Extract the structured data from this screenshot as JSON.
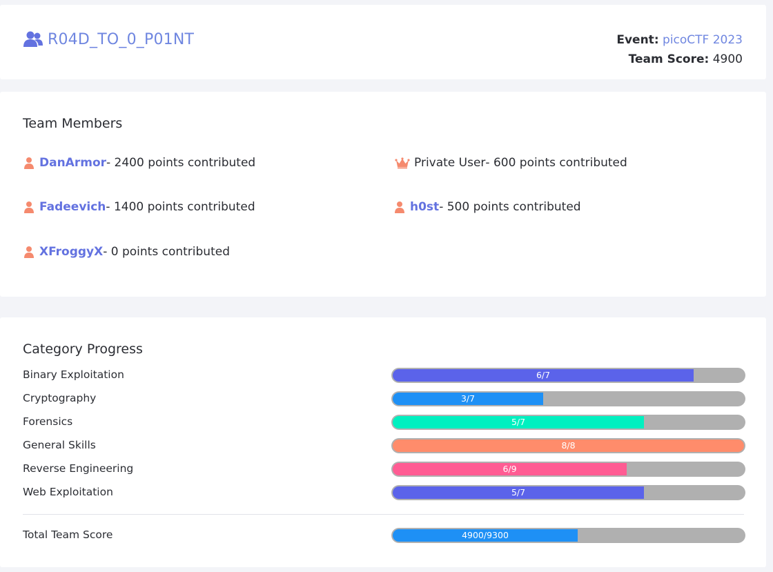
{
  "team": {
    "name": "R04D_TO_0_P01NT",
    "icon": "users-icon",
    "color": "#6f86e0"
  },
  "event": {
    "event_label": "Event:",
    "event_name": "picoCTF 2023",
    "score_label": "Team Score:",
    "score_value": "4900"
  },
  "members_section": {
    "title": "Team Members",
    "members": [
      {
        "name": "DanArmor",
        "rest": " - 2400 points contributed",
        "icon": "user-icon",
        "link": true
      },
      {
        "name": "Private User",
        "rest": " - 600 points contributed",
        "icon": "crown-icon",
        "link": false
      },
      {
        "name": "Fadeevich",
        "rest": " - 1400 points contributed",
        "icon": "user-icon",
        "link": true
      },
      {
        "name": "h0st",
        "rest": " - 500 points contributed",
        "icon": "user-icon",
        "link": true
      },
      {
        "name": "XFroggyX",
        "rest": " - 0 points contributed",
        "icon": "user-icon",
        "link": true
      }
    ]
  },
  "progress_section": {
    "title": "Category Progress",
    "categories": [
      {
        "label": "Binary Exploitation",
        "solved": 6,
        "total": 7,
        "text": "6/7",
        "color": "#5b63ea"
      },
      {
        "label": "Cryptography",
        "solved": 3,
        "total": 7,
        "text": "3/7",
        "color": "#1e90f5"
      },
      {
        "label": "Forensics",
        "solved": 5,
        "total": 7,
        "text": "5/7",
        "color": "#00f0c0"
      },
      {
        "label": "General Skills",
        "solved": 8,
        "total": 8,
        "text": "8/8",
        "color": "#ff8c6b"
      },
      {
        "label": "Reverse Engineering",
        "solved": 6,
        "total": 9,
        "text": "6/9",
        "color": "#ff5c93"
      },
      {
        "label": "Web Exploitation",
        "solved": 5,
        "total": 7,
        "text": "5/7",
        "color": "#5b63ea"
      }
    ],
    "total": {
      "label": "Total Team Score",
      "score": 4900,
      "max": 9300,
      "text": "4900/9300",
      "color": "#1e90f5"
    }
  },
  "colors": {
    "icon_accent": "#f58a6e",
    "track": "#b0b0b0"
  }
}
